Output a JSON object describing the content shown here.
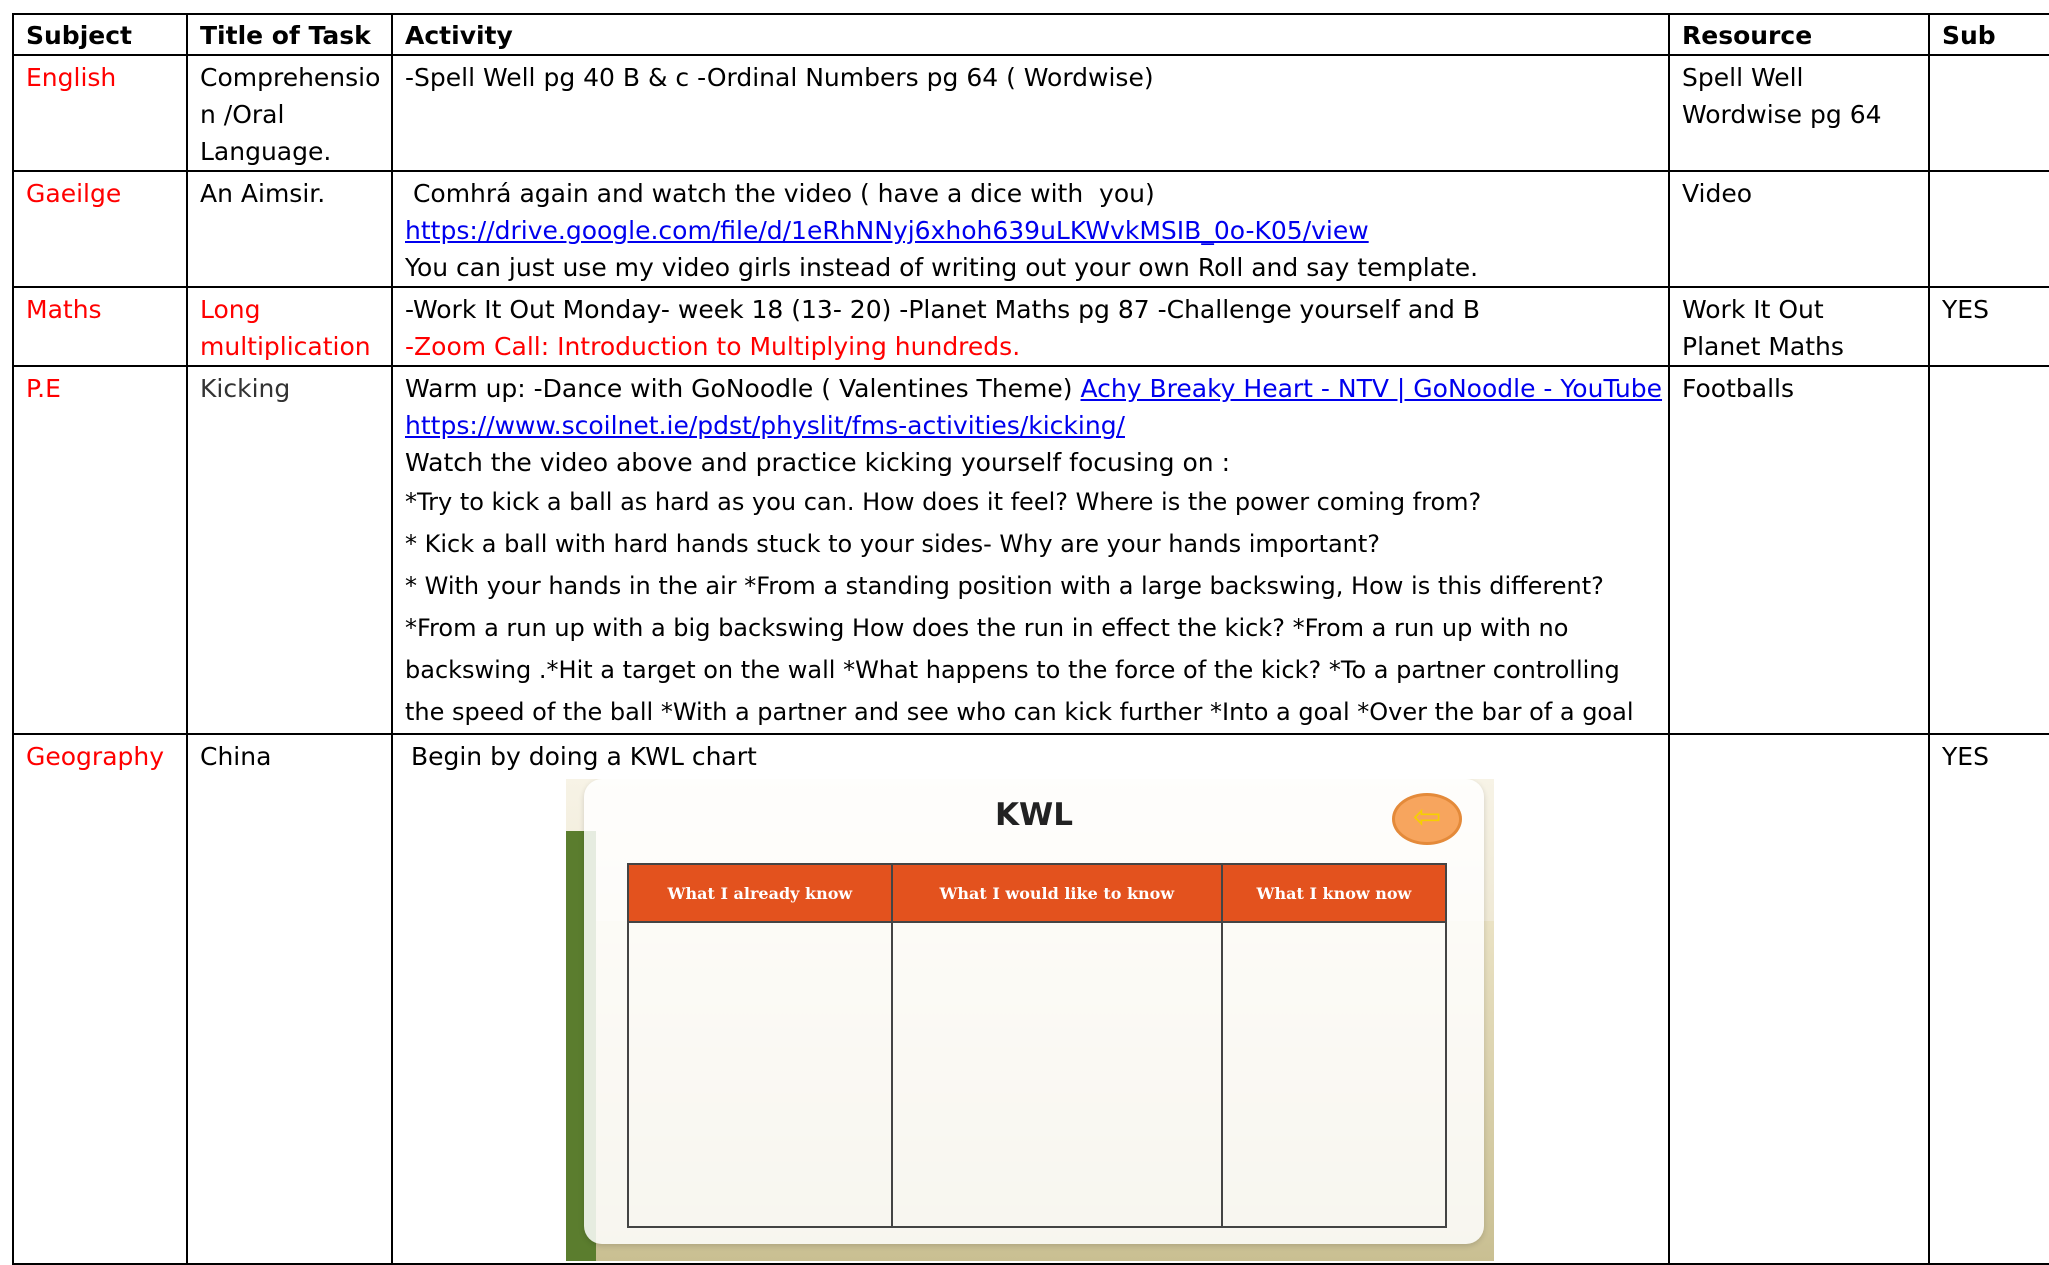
{
  "headers": {
    "subject": "Subject",
    "title": "Title of Task",
    "activity": "Activity",
    "resource": "Resource",
    "sub": "Sub"
  },
  "rows": [
    {
      "subject": "English",
      "title": [
        "Comprehensio",
        "n /Oral",
        "Language."
      ],
      "activity": "-Spell Well pg 40 B & c -Ordinal Numbers pg 64 ( Wordwise)",
      "resource": [
        "Spell Well",
        "Wordwise pg 64"
      ],
      "sub": ""
    },
    {
      "subject": "Gaeilge",
      "title": [
        "An Aimsir."
      ],
      "activity_lines": [
        " Comhrá again and watch the video ( have a dice with  you)",
        "https://drive.google.com/file/d/1eRhNNyj6xhoh639uLKWvkMSIB_0o-K05/view",
        "You can  just use my video girls instead of writing out your own Roll and say template."
      ],
      "resource": [
        "Video"
      ],
      "sub": ""
    },
    {
      "subject": "Maths",
      "title": [
        "Long",
        "multiplication"
      ],
      "activity_lines": [
        "-Work It Out Monday- week 18  (13- 20) -Planet Maths pg 87 -Challenge  yourself and B",
        "-Zoom Call: Introduction to Multiplying hundreds."
      ],
      "resource": [
        "Work It Out",
        "Planet Maths"
      ],
      "sub": "YES"
    },
    {
      "subject": "P.E",
      "title": [
        "Kicking"
      ],
      "activity_intro": "Warm up: -Dance with GoNoodle ( Valentines Theme) ",
      "activity_link1": "Achy Breaky Heart - NTV | GoNoodle - YouTube",
      "activity_link2": "https://www.scoilnet.ie/pdst/physlit/fms-activities/kicking/",
      "activity_line3": "Watch the video above and practice kicking yourself focusing on :",
      "activity_small": [
        "*Try to kick a ball  as hard as you can. How does it feel? Where is the power coming from?",
        "* Kick a ball with hard hands stuck to your sides-  Why are your hands important?",
        "* With your hands in the air *From a standing position with a large backswing,  How is this different?",
        "*From a run up with a big backswing How does the run in effect the kick? *From a run up with no",
        "backswing .*Hit a target on the wall *What happens to the force of the kick? *To a partner controlling",
        "the speed of the ball *With a partner and see who can kick further *Into a goal *Over the bar of a goal"
      ],
      "resource": [
        "Footballs"
      ],
      "sub": ""
    },
    {
      "subject": "Geography",
      "title": [
        "China"
      ],
      "activity": " Begin by doing a KWL chart",
      "resource": [],
      "sub": "YES"
    }
  ],
  "kwl": {
    "title": "KWL",
    "back_icon": "arrow-left-icon",
    "columns": [
      "What I already know",
      "What I would like to know",
      "What I know now"
    ],
    "colors": {
      "header": "#e3521e",
      "back": "#f7a55e"
    }
  },
  "colors": {
    "subject": "#ff0000",
    "link": "#0000ee"
  }
}
